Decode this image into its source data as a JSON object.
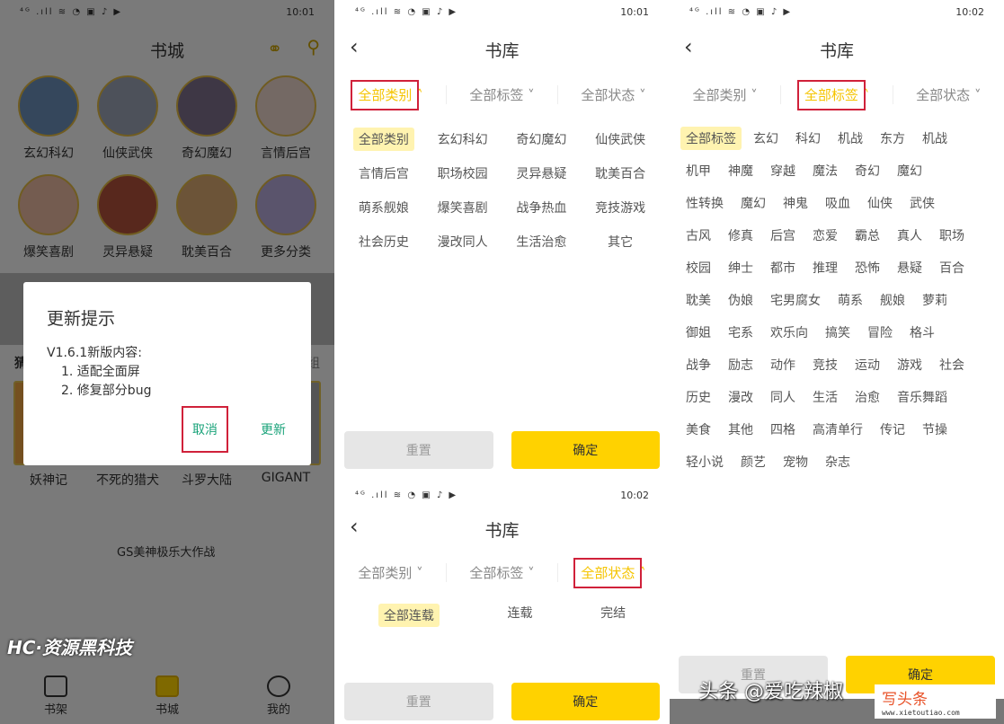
{
  "status": {
    "left": "⁴ᴳ .ıll ≋ ◔ ▣ ♪ ▶",
    "time1": "10:01",
    "time2": "10:02"
  },
  "store": {
    "title": "书城",
    "categories": [
      "玄幻科幻",
      "仙侠武侠",
      "奇幻魔幻",
      "言情后宫",
      "爆笑喜剧",
      "灵异悬疑",
      "耽美百合",
      "更多分类"
    ],
    "section": "猜你喜欢",
    "section_right": "换一组",
    "books": [
      "妖神记",
      "不死的猎犬",
      "斗罗大陆",
      "GIGANT"
    ],
    "promo": "GS美神极乐大作战",
    "nav": [
      "书架",
      "书城",
      "我的"
    ],
    "colors": {
      "accent": "#ffd200",
      "circle_border": "#e0b842"
    }
  },
  "dialog": {
    "title": "更新提示",
    "version": "V1.6.1新版内容:",
    "items": [
      "1. 适配全面屏",
      "2. 修复部分bug"
    ],
    "cancel": "取消",
    "update": "更新",
    "colors": {
      "button": "#1aa37a",
      "highlight": "#d0213a"
    }
  },
  "library": {
    "title": "书库",
    "filters": [
      "全部类别",
      "全部标签",
      "全部状态"
    ],
    "reset": "重置",
    "confirm": "确定"
  },
  "categories": [
    "全部类别",
    "玄幻科幻",
    "奇幻魔幻",
    "仙侠武侠",
    "言情后宫",
    "职场校园",
    "灵异悬疑",
    "耽美百合",
    "萌系舰娘",
    "爆笑喜剧",
    "战争热血",
    "竞技游戏",
    "社会历史",
    "漫改同人",
    "生活治愈",
    "其它"
  ],
  "states": [
    "全部连载",
    "连载",
    "完结"
  ],
  "tags": [
    [
      "全部标签",
      "玄幻",
      "科幻",
      "机战",
      "东方",
      "机战"
    ],
    [
      "机甲",
      "神魔",
      "穿越",
      "魔法",
      "奇幻",
      "魔幻"
    ],
    [
      "性转换",
      "魔幻",
      "神鬼",
      "吸血",
      "仙侠",
      "武侠"
    ],
    [
      "古风",
      "修真",
      "后宫",
      "恋爱",
      "霸总",
      "真人",
      "职场"
    ],
    [
      "校园",
      "绅士",
      "都市",
      "推理",
      "恐怖",
      "悬疑",
      "百合"
    ],
    [
      "耽美",
      "伪娘",
      "宅男腐女",
      "萌系",
      "舰娘",
      "萝莉"
    ],
    [
      "御姐",
      "宅系",
      "欢乐向",
      "搞笑",
      "冒险",
      "格斗"
    ],
    [
      "战争",
      "励志",
      "动作",
      "竞技",
      "运动",
      "游戏",
      "社会"
    ],
    [
      "历史",
      "漫改",
      "同人",
      "生活",
      "治愈",
      "音乐舞蹈"
    ],
    [
      "美食",
      "其他",
      "四格",
      "高清单行",
      "传记",
      "节操"
    ],
    [
      "轻小说",
      "颜艺",
      "宠物",
      "杂志"
    ]
  ],
  "watermarks": {
    "wm1": "HC·资源黑科技",
    "wm2": "头条 @爱吃辣椒",
    "wm3": "写头条",
    "wm4": "www.xietoutiao.com"
  }
}
